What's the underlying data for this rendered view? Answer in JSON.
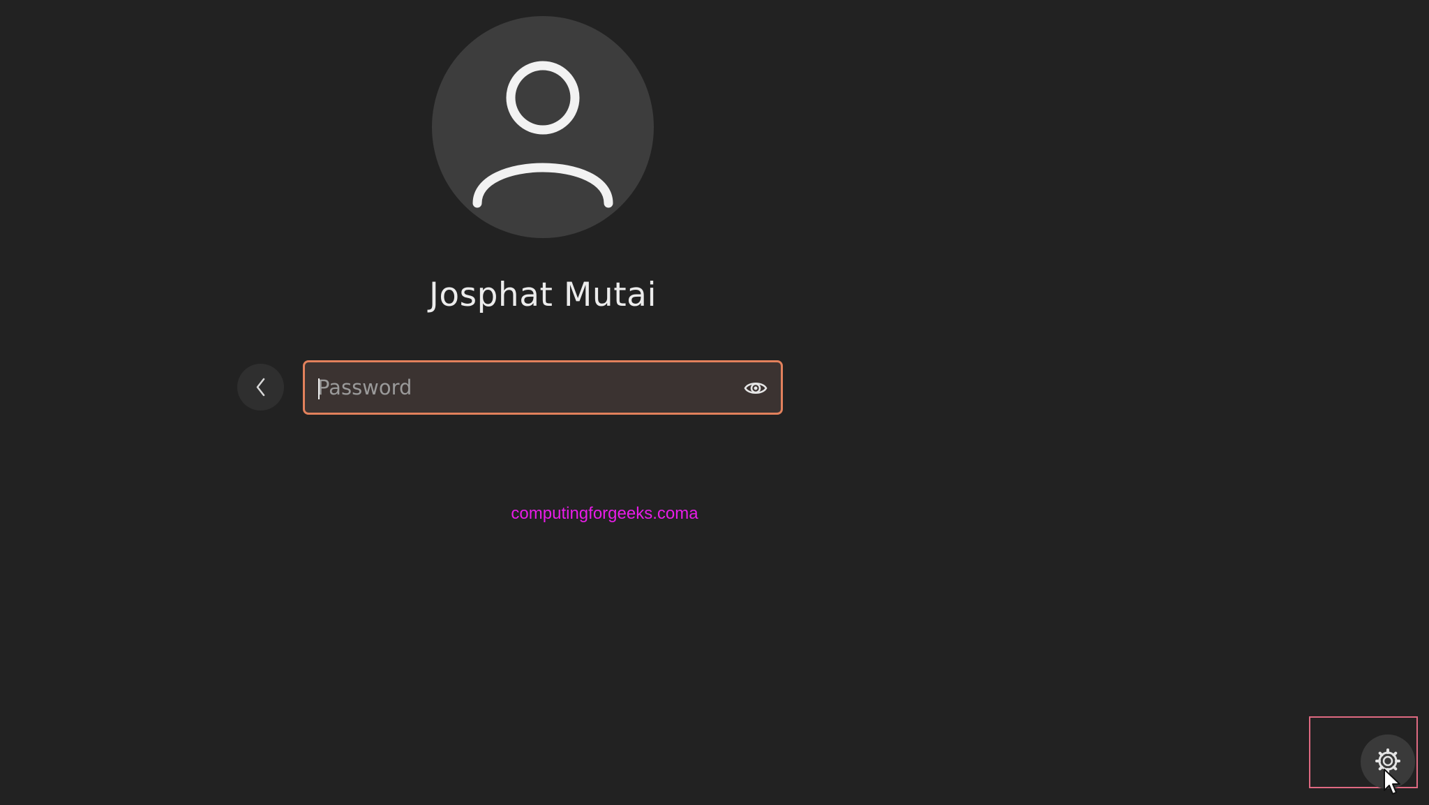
{
  "login": {
    "user_name": "Josphat Mutai",
    "password_placeholder": "Password",
    "password_value": ""
  },
  "watermark": {
    "text": "computingforgeeks.coma"
  },
  "icons": {
    "avatar": "user-silhouette-icon",
    "back": "chevron-left-icon",
    "reveal": "eye-icon",
    "system": "gear-icon",
    "pointer": "mouse-pointer-icon"
  },
  "colors": {
    "background": "#222222",
    "avatar_bg": "#3d3d3d",
    "focus_border": "#e2815c",
    "input_bg": "#3b3331",
    "watermark": "#e81ce8",
    "highlight": "#e06a82"
  }
}
